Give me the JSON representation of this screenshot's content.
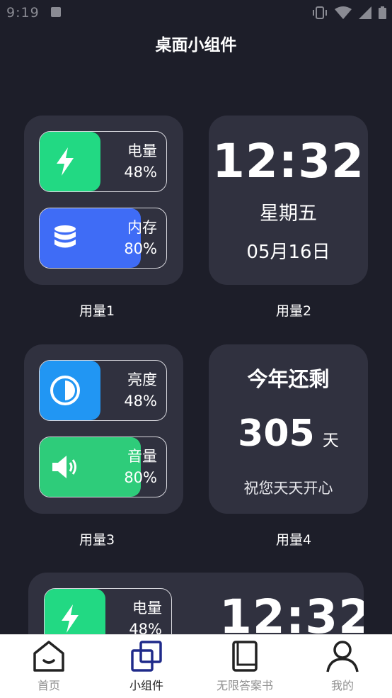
{
  "status": {
    "time": "9:19"
  },
  "page": {
    "title": "桌面小组件"
  },
  "widget1": {
    "battery": {
      "label": "电量",
      "value": "48%",
      "level": 0.48,
      "color": "#22d983"
    },
    "memory": {
      "label": "内存",
      "value": "80%",
      "level": 0.8,
      "color": "#3f6cf6"
    },
    "caption": "用量1"
  },
  "widget2": {
    "time": "12:32",
    "weekday": "星期五",
    "date": "05月16日",
    "caption": "用量2"
  },
  "widget3": {
    "brightness": {
      "label": "亮度",
      "value": "48%",
      "level": 0.48,
      "color": "#2196f3"
    },
    "volume": {
      "label": "音量",
      "value": "80%",
      "level": 0.8,
      "color": "#2ecc7a"
    },
    "caption": "用量3"
  },
  "widget4": {
    "heading": "今年还剩",
    "days": "305",
    "unit": "天",
    "wish": "祝您天天开心",
    "caption": "用量4"
  },
  "widget5": {
    "battery_label": "电量",
    "battery_value": "48%",
    "time": "12:32"
  },
  "nav": {
    "home": "首页",
    "widgets": "小组件",
    "answers": "无限答案书",
    "mine": "我的"
  }
}
